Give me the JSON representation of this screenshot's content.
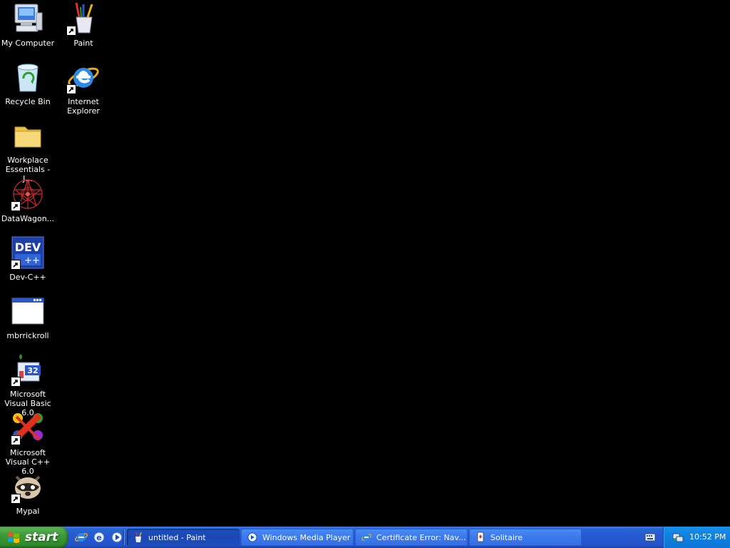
{
  "desktop": {
    "icons": [
      {
        "label": "My Computer"
      },
      {
        "label": "Paint"
      },
      {
        "label": "Recycle Bin"
      },
      {
        "label": "Internet Explorer"
      },
      {
        "label": "Workplace Essentials - J..."
      },
      {
        "label": "DataWagon..."
      },
      {
        "label": "Dev-C++"
      },
      {
        "label": "mbrrickroll"
      },
      {
        "label": "Microsoft Visual Basic 6.0"
      },
      {
        "label": "Microsoft Visual C++ 6.0"
      },
      {
        "label": "Mypal"
      }
    ],
    "background_color": "#000000"
  },
  "taskbar": {
    "start_label": "start",
    "tasks": [
      {
        "label": "untitled - Paint",
        "icon": "paint-icon",
        "active": true
      },
      {
        "label": "Windows Media Player",
        "icon": "media-player-icon",
        "active": false
      },
      {
        "label": "Certificate Error: Nav...",
        "icon": "internet-explorer-icon",
        "active": false
      },
      {
        "label": "Solitaire",
        "icon": "solitaire-icon",
        "active": false
      }
    ],
    "quick_launch": [
      "internet-explorer-icon",
      "ie-icon",
      "media-player-icon"
    ],
    "clock": "10:52 PM",
    "colors": {
      "taskbar": "#2458d0",
      "start": "#3d9a38",
      "tray": "#0f7fe0"
    }
  }
}
